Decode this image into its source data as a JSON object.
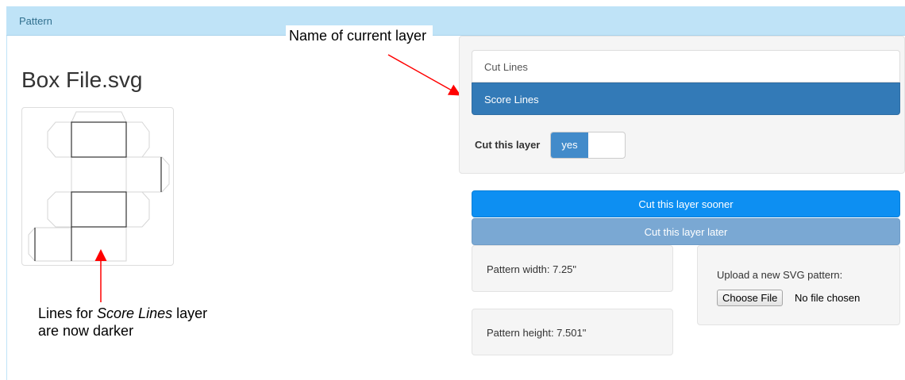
{
  "panel": {
    "title": "Pattern"
  },
  "file": {
    "title": "Box File.svg"
  },
  "annotations": {
    "current_layer": "Name of current layer",
    "score_note_prefix": "Lines for ",
    "score_note_italic": "Score Lines",
    "score_note_suffix": " layer",
    "score_note_line2": "are now darker"
  },
  "layers": [
    {
      "label": "Cut Lines",
      "active": false
    },
    {
      "label": "Score Lines",
      "active": true
    }
  ],
  "cut_toggle": {
    "label": "Cut this layer",
    "value": "yes"
  },
  "buttons": {
    "sooner": "Cut this layer sooner",
    "later": "Cut this layer later"
  },
  "dimensions": {
    "width": "Pattern width: 7.25\"",
    "height": "Pattern height: 7.501\""
  },
  "upload": {
    "label": "Upload a new SVG pattern:",
    "button": "Choose File",
    "status": "No file chosen"
  },
  "colors": {
    "accent": "#337ab7",
    "arrow": "#ff0000",
    "header": "#bfe3f7"
  }
}
